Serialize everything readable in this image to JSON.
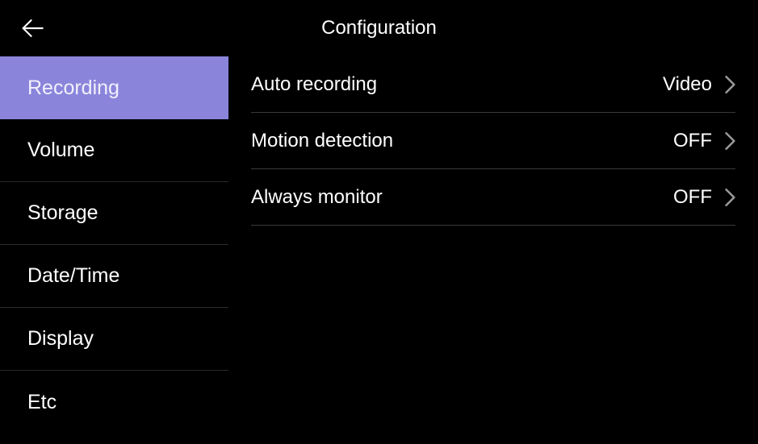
{
  "header": {
    "title": "Configuration"
  },
  "sidebar": {
    "items": [
      {
        "label": "Recording",
        "active": true
      },
      {
        "label": "Volume",
        "active": false
      },
      {
        "label": "Storage",
        "active": false
      },
      {
        "label": "Date/Time",
        "active": false
      },
      {
        "label": "Display",
        "active": false
      },
      {
        "label": "Etc",
        "active": false
      }
    ]
  },
  "settings": [
    {
      "label": "Auto recording",
      "value": "Video"
    },
    {
      "label": "Motion detection",
      "value": "OFF"
    },
    {
      "label": "Always monitor",
      "value": "OFF"
    }
  ]
}
